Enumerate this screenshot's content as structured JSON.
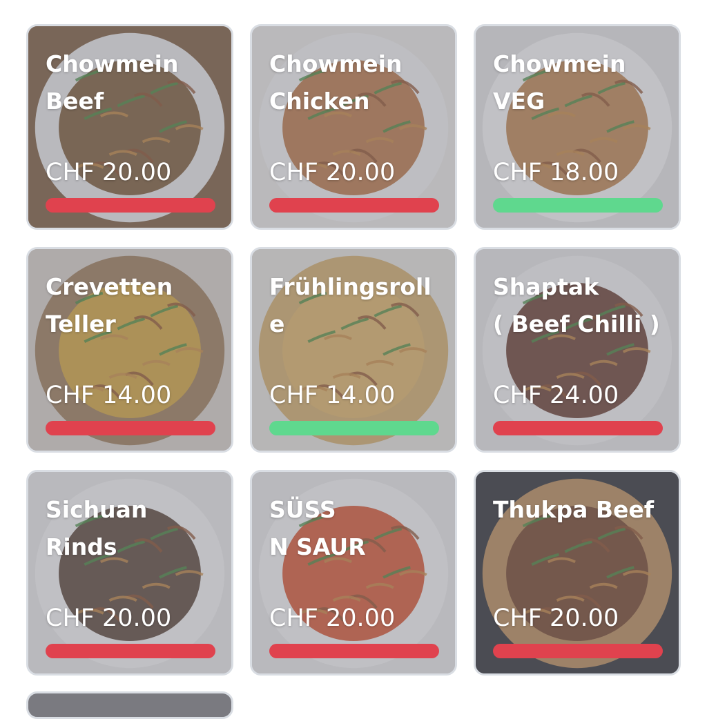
{
  "menu": {
    "items": [
      {
        "title": "Chowmein\nBeef",
        "price": "CHF 20.00",
        "status": "unavailable",
        "bar_color": "#e0424e",
        "photo": "chowmein-beef-photo",
        "photo_bg": "#7b5a3c",
        "plate": "#e9e9e9",
        "food": "#6e4a22"
      },
      {
        "title": "Chowmein\nChicken",
        "price": "CHF 20.00",
        "status": "unavailable",
        "bar_color": "#e0424e",
        "photo": "chowmein-chicken-photo",
        "photo_bg": "#ebe9e6",
        "plate": "#f2f2f2",
        "food": "#b56a34"
      },
      {
        "title": "Chowmein\nVEG",
        "price": "CHF 18.00",
        "status": "available",
        "bar_color": "#5fd88e",
        "photo": "chowmein-veg-photo",
        "photo_bg": "#e4e4e4",
        "plate": "#f6f6f6",
        "food": "#b87a3e"
      },
      {
        "title": "Crevetten\nTeller",
        "price": "CHF 14.00",
        "status": "unavailable",
        "bar_color": "#e0424e",
        "photo": "crevetten-teller-photo",
        "photo_bg": "#d8d0c8",
        "plate": "#9b7b56",
        "food": "#d9a93a"
      },
      {
        "title": "Frühlingsroll\ne",
        "price": "CHF 14.00",
        "status": "available",
        "bar_color": "#5fd88e",
        "photo": "fruehlingsrolle-photo",
        "photo_bg": "#e6e3dc",
        "plate": "#d2ad6a",
        "food": "#e0b566"
      },
      {
        "title": "Shaptak\n( Beef Chilli )",
        "price": "CHF 24.00",
        "status": "unavailable",
        "bar_color": "#e0424e",
        "photo": "shaptak-photo",
        "photo_bg": "#e6e6e6",
        "plate": "#f2f2f2",
        "food": "#5a2a1c"
      },
      {
        "title": "Sichuan\nRinds",
        "price": "CHF 20.00",
        "status": "unavailable",
        "bar_color": "#e0424e",
        "photo": "sichuan-rinds-photo",
        "photo_bg": "#e8e8e8",
        "plate": "#f4f4f4",
        "food": "#4a3222"
      },
      {
        "title": "SÜSS\nN SAUR",
        "price": "CHF 20.00",
        "status": "unavailable",
        "bar_color": "#e0424e",
        "photo": "suess-n-saur-photo",
        "photo_bg": "#e8e8e8",
        "plate": "#f4f4f4",
        "food": "#d4451e"
      },
      {
        "title": "Thukpa Beef",
        "price": "CHF 20.00",
        "status": "unavailable",
        "bar_color": "#e0424e",
        "photo": "thukpa-beef-photo",
        "photo_bg": "#2c2e33",
        "plate": "#b98b56",
        "food": "#6a3a22"
      }
    ]
  }
}
